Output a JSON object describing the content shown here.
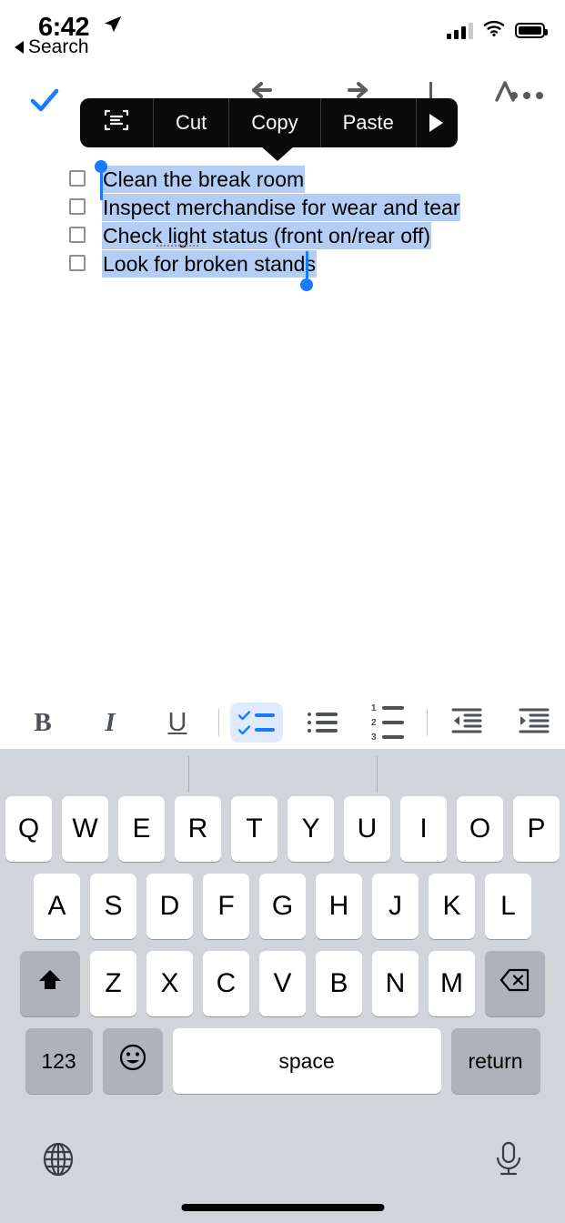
{
  "status_bar": {
    "time": "6:42",
    "location_icon": "location-arrow-icon",
    "signal_icon": "cellular-signal-icon",
    "wifi_icon": "wifi-icon",
    "battery_icon": "battery-full-icon"
  },
  "back_link": {
    "label": "Search",
    "icon": "back-triangle-icon"
  },
  "note_toolbar": {
    "done_icon": "checkmark-icon",
    "more_label": "•••",
    "hidden_icons": [
      "undo-icon",
      "redo-icon",
      "divider-icon",
      "text-format-icon"
    ],
    "accent_color": "#1a7aff"
  },
  "edit_menu": {
    "items": [
      {
        "label": "",
        "icon": "scan-text-icon",
        "name": "scan-text-button"
      },
      {
        "label": "Cut",
        "icon": "",
        "name": "cut-button"
      },
      {
        "label": "Copy",
        "icon": "",
        "name": "copy-button"
      },
      {
        "label": "Paste",
        "icon": "",
        "name": "paste-button"
      },
      {
        "label": "",
        "icon": "chevron-right-icon",
        "name": "more-menu-button"
      }
    ],
    "background_color": "#0a0a0a"
  },
  "note": {
    "checklist": [
      {
        "text": "Clean the break room",
        "checked": false
      },
      {
        "text": "Inspect merchandise for wear and tear",
        "checked": false
      },
      {
        "text": "Check light status (front on/rear off)",
        "checked": false
      },
      {
        "text": "Look for broken stands",
        "checked": false
      }
    ],
    "selection_color": "#b3cdf5",
    "handle_color": "#1a7aff",
    "all_selected": true
  },
  "format_toolbar": {
    "items": [
      {
        "label": "B",
        "name": "bold-button",
        "active": false
      },
      {
        "label": "I",
        "name": "italic-button",
        "active": false
      },
      {
        "label": "U",
        "name": "underline-button",
        "active": false
      },
      {
        "label": "",
        "name": "checklist-button",
        "active": true
      },
      {
        "label": "",
        "name": "bullet-list-button",
        "active": false
      },
      {
        "label": "",
        "name": "numbered-list-button",
        "active": false
      },
      {
        "label": "",
        "name": "outdent-button",
        "active": false
      },
      {
        "label": "",
        "name": "indent-button",
        "active": false
      }
    ],
    "numbered_labels": [
      "1",
      "2",
      "3"
    ],
    "active_bg": "#dfeaff",
    "icon_color": "#4d5159"
  },
  "keyboard": {
    "predictive_suggestions": [
      "",
      "",
      ""
    ],
    "row1": [
      "Q",
      "W",
      "E",
      "R",
      "T",
      "Y",
      "U",
      "I",
      "O",
      "P"
    ],
    "row2": [
      "A",
      "S",
      "D",
      "F",
      "G",
      "H",
      "J",
      "K",
      "L"
    ],
    "row3": [
      "Z",
      "X",
      "C",
      "V",
      "B",
      "N",
      "M"
    ],
    "shift_icon": "shift-up-arrow-icon",
    "backspace_icon": "backspace-delete-icon",
    "numbers_key": "123",
    "emoji_icon": "emoji-smiley-icon",
    "space_key": "space",
    "return_key": "return",
    "globe_icon": "globe-language-icon",
    "mic_icon": "microphone-dictation-icon",
    "background_color": "#d1d4d9",
    "key_color": "#ffffff",
    "modifier_key_color": "#aeb3bb"
  }
}
